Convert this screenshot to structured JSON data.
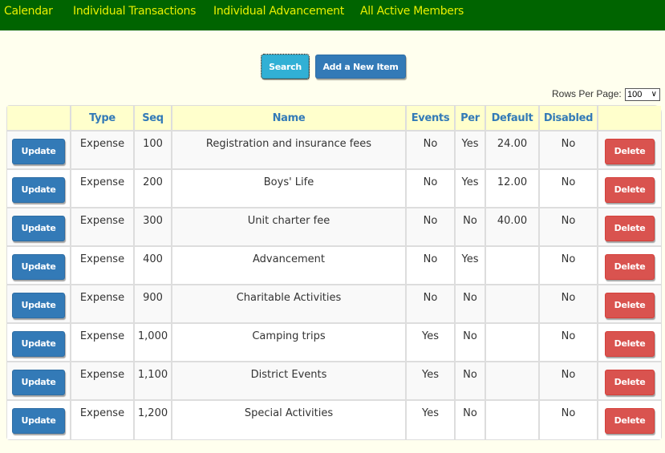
{
  "nav": {
    "items": [
      {
        "label": "Calendar"
      },
      {
        "label": "Individual Transactions"
      },
      {
        "label": "Individual Advancement"
      },
      {
        "label": "All Active Members"
      }
    ]
  },
  "toolbar": {
    "search_label": "Search",
    "add_label": "Add a New Item"
  },
  "pagination": {
    "rows_per_page_label": "Rows Per Page:",
    "rows_per_page_value": "100",
    "chevron": "∨"
  },
  "colors": {
    "nav_bg": "#006400",
    "nav_text": "#e8f000",
    "page_bg": "#ffffee",
    "header_bg": "#ffffcc",
    "header_text": "#337ab7",
    "update_button": "#337ab7",
    "delete_button": "#d9534f",
    "search_button": "#31b0d5"
  },
  "table": {
    "columns": [
      "",
      "Type",
      "Seq",
      "Name",
      "Events",
      "Per",
      "Default",
      "Disabled",
      ""
    ],
    "update_label": "Update",
    "delete_label": "Delete",
    "rows": [
      {
        "type": "Expense",
        "seq": "100",
        "name": "Registration and insurance fees",
        "events": "No",
        "per": "Yes",
        "default": "24.00",
        "disabled": "No"
      },
      {
        "type": "Expense",
        "seq": "200",
        "name": "Boys' Life",
        "events": "No",
        "per": "Yes",
        "default": "12.00",
        "disabled": "No"
      },
      {
        "type": "Expense",
        "seq": "300",
        "name": "Unit charter fee",
        "events": "No",
        "per": "No",
        "default": "40.00",
        "disabled": "No"
      },
      {
        "type": "Expense",
        "seq": "400",
        "name": "Advancement",
        "events": "No",
        "per": "Yes",
        "default": "",
        "disabled": "No"
      },
      {
        "type": "Expense",
        "seq": "900",
        "name": "Charitable Activities",
        "events": "No",
        "per": "No",
        "default": "",
        "disabled": "No"
      },
      {
        "type": "Expense",
        "seq": "1,000",
        "name": "Camping trips",
        "events": "Yes",
        "per": "No",
        "default": "",
        "disabled": "No"
      },
      {
        "type": "Expense",
        "seq": "1,100",
        "name": "District Events",
        "events": "Yes",
        "per": "No",
        "default": "",
        "disabled": "No"
      },
      {
        "type": "Expense",
        "seq": "1,200",
        "name": "Special Activities",
        "events": "Yes",
        "per": "No",
        "default": "",
        "disabled": "No"
      }
    ]
  }
}
